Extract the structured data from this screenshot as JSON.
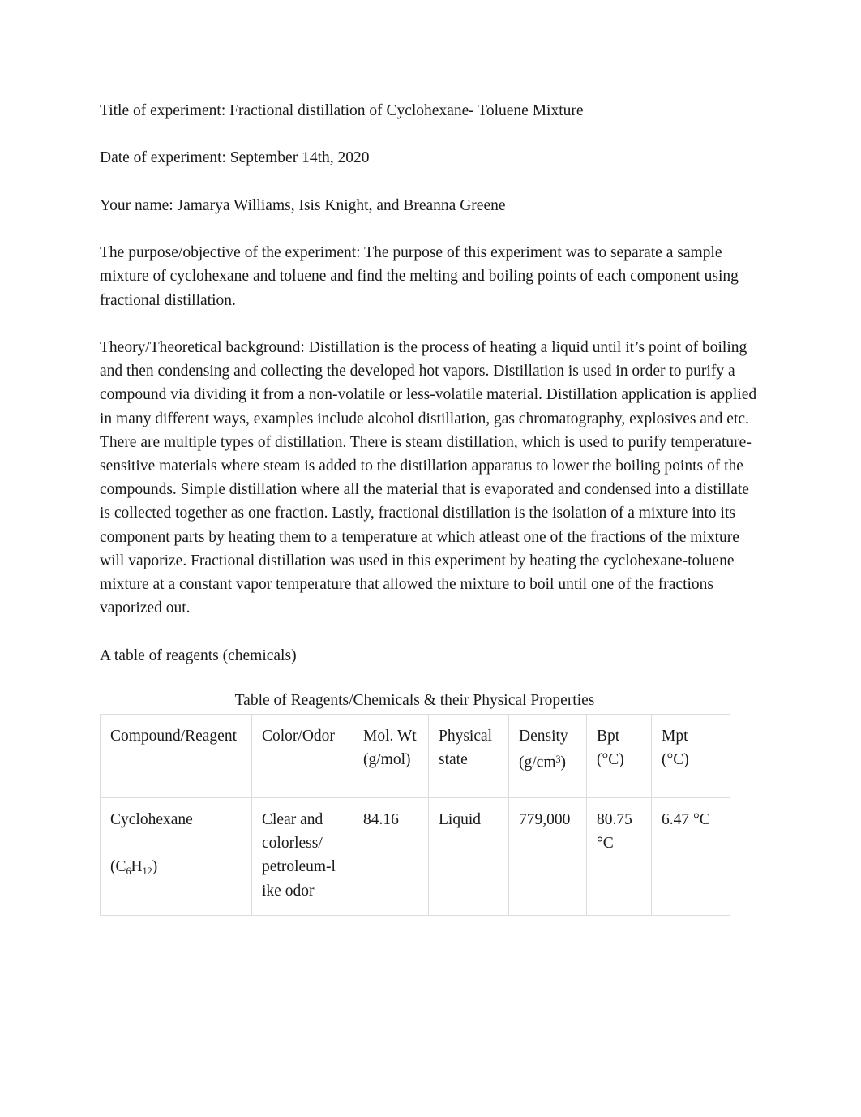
{
  "document": {
    "header_fields": [
      {
        "label": "Title of experiment:",
        "value": "Fractional distillation of Cyclohexane- Toluene Mixture",
        "full": "Title of experiment:   Fractional distillation of Cyclohexane- Toluene Mixture"
      },
      {
        "label": "Date of experiment:",
        "value": "September 14th, 2020",
        "full": "Date of experiment:   September 14th, 2020"
      },
      {
        "label": "Your name:",
        "value": "Jamarya Williams, Isis Knight, and Breanna Greene",
        "full": "Your name:  Jamarya Williams, Isis Knight, and Breanna Greene"
      }
    ],
    "purpose": {
      "label": "The purpose/objective of the experiment:",
      "text": "The purpose of this experiment was to separate a sample mixture of cyclohexane and toluene and find the melting and boiling points of each component using fractional distillation.",
      "full": "The purpose/objective of the experiment:     The purpose of this experiment was to separate a sample mixture of cyclohexane and toluene and find the melting and boiling points of each component using fractional distillation."
    },
    "theory": {
      "label": "Theory/Theoretical background:",
      "text": "Distillation is the process of heating a liquid until it’s point of boiling and then condensing and collecting the developed hot vapors. Distillation is used in order to purify a compound via dividing it from a non-volatile or less-volatile material. Distillation application is applied in many different ways, examples include alcohol distillation, gas chromatography, explosives and etc. There are multiple types of distillation. There is steam distillation, which is used to purify temperature-sensitive materials where steam is added to the distillation apparatus to lower the boiling points of the compounds. Simple distillation where all the material that is evaporated and condensed into a distillate is collected together as one fraction. Lastly, fractional distillation is the isolation of a mixture into its component parts by heating them to a temperature at which atleast one of the fractions of the mixture will vaporize. Fractional distillation was used in this experiment by heating the cyclohexane-toluene mixture at a constant vapor temperature that allowed the mixture to boil until one of the fractions vaporized out.",
      "full": "Theory/Theoretical background:     Distillation is the process of heating a liquid until it’s point of boiling and then condensing and collecting the developed hot vapors. Distillation is used in order to purify a compound via dividing it from a non-volatile or less-volatile material. Distillation application is applied in many different ways, examples include alcohol distillation, gas chromatography, explosives and etc. There are multiple types of distillation. There is steam distillation, which is used to purify temperature-sensitive materials where steam is added to the distillation apparatus to lower the boiling points of the compounds. Simple distillation where all the material that is evaporated and condensed into a distillate is collected together as one fraction. Lastly, fractional distillation is the isolation of a mixture into its component parts by heating them to a temperature at which atleast one of the fractions of the mixture will vaporize. Fractional distillation was used in this experiment by heating the cyclohexane-toluene mixture at a constant vapor temperature that allowed the mixture to boil until one of the fractions vaporized out."
    },
    "reagents_intro": "A table of reagents (chemicals)",
    "table": {
      "caption": "Table of Reagents/Chemicals & their Physical Properties",
      "headers": [
        {
          "line1": "Compound/Reagent",
          "line2": ""
        },
        {
          "line1": "Color/Odor",
          "line2": ""
        },
        {
          "line1": "Mol. Wt",
          "line2": "(g/mol)"
        },
        {
          "line1": "Physical",
          "line2": "state"
        },
        {
          "line1": "Density",
          "line2": "(g/cm3)"
        },
        {
          "line1": "Bpt",
          "line2": "(°C)"
        },
        {
          "line1": "Mpt",
          "line2": "(°C)"
        }
      ],
      "rows": [
        {
          "compound_name": "Cyclohexane",
          "compound_formula_open": "(C",
          "compound_formula_sub1": "6",
          "compound_formula_mid": "H",
          "compound_formula_sub2": "12",
          "compound_formula_close": ")",
          "color_odor": "Clear and colorless/ petroleum-like odor",
          "color_odor_line1": "Clear and",
          "color_odor_line2": "colorless/",
          "color_odor_line3": "petroleum-l",
          "color_odor_line4": "ike odor",
          "mol_wt": "84.16",
          "physical_state": "Liquid",
          "density": "779,000",
          "bpt": "80.75 °C",
          "mpt": "6.47 °C"
        }
      ]
    }
  }
}
